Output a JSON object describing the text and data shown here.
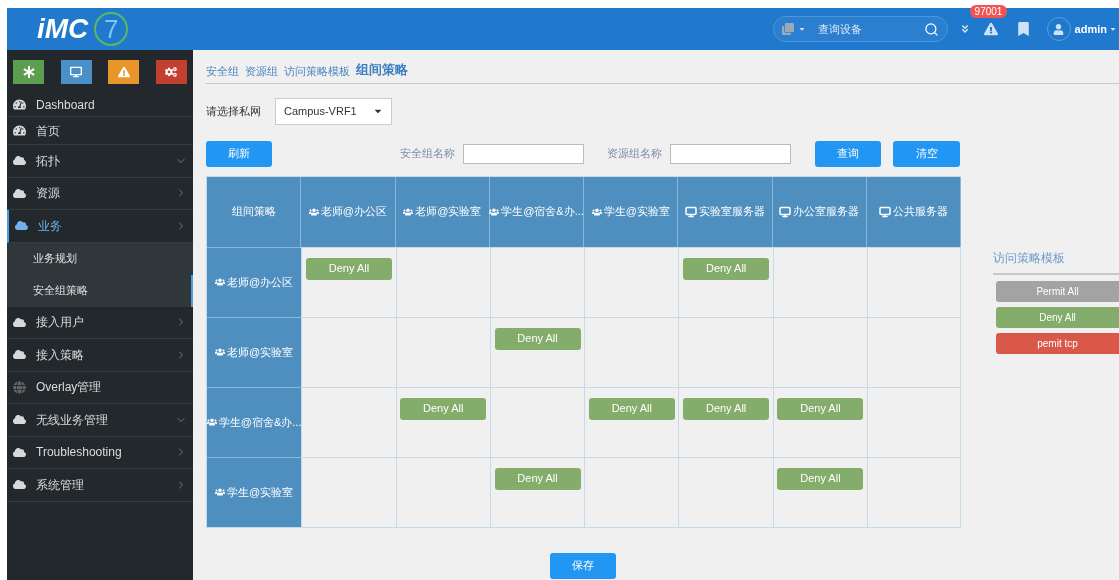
{
  "header": {
    "logo": "iMC",
    "logo_version": "7",
    "search": {
      "placeholder": "查询设备"
    },
    "alarm_badge": "97001",
    "user": "admin"
  },
  "quick_buttons": [
    {
      "kind": "asterisk",
      "color": "#5a9e4e"
    },
    {
      "kind": "monitor",
      "color": "#4a90c8"
    },
    {
      "kind": "warning",
      "color": "#e8962a"
    },
    {
      "kind": "gears",
      "color": "#c2402f"
    }
  ],
  "sidebar": {
    "items": [
      {
        "label": "Dashboard",
        "kind": "gauge",
        "selected": false
      },
      {
        "label": "首页",
        "kind": "gauge",
        "selected": false
      },
      {
        "label": "拓扑",
        "kind": "cloud",
        "expanded": true,
        "selected": false
      },
      {
        "label": "资源",
        "kind": "cloud",
        "expanded": false,
        "selected": false
      },
      {
        "label": "业务",
        "kind": "cloud",
        "expanded": false,
        "selected": true,
        "children": [
          {
            "label": "业务规划",
            "selected": false
          },
          {
            "label": "安全组策略",
            "selected": true
          }
        ]
      },
      {
        "label": "接入用户",
        "kind": "cloud",
        "expanded": false,
        "selected": false
      },
      {
        "label": "接入策略",
        "kind": "cloud",
        "expanded": false,
        "selected": false
      },
      {
        "label": "Overlay管理",
        "kind": "globe",
        "selected": false
      },
      {
        "label": "无线业务管理",
        "kind": "cloud",
        "expanded": true,
        "selected": false
      },
      {
        "label": "Troubleshooting",
        "kind": "cloud",
        "expanded": false,
        "selected": false
      },
      {
        "label": "系统管理",
        "kind": "cloud",
        "expanded": false,
        "selected": false
      }
    ]
  },
  "breadcrumb": [
    {
      "label": "安全组",
      "selected": false
    },
    {
      "label": "资源组",
      "selected": false
    },
    {
      "label": "访问策略模板",
      "selected": false
    },
    {
      "label": "组间策略",
      "selected": true
    }
  ],
  "vpn_select": {
    "label": "请选择私网",
    "value": "Campus-VRF1"
  },
  "toolbar": {
    "refresh": "刷新",
    "security_group_label": "安全组名称",
    "resource_group_label": "资源组名称",
    "query": "查询",
    "clear": "清空"
  },
  "matrix": {
    "corner": "组间策略",
    "columns": [
      {
        "label": "老师@办公区",
        "kind": "user"
      },
      {
        "label": "老师@实验室",
        "kind": "user"
      },
      {
        "label": "学生@宿舍&办...",
        "kind": "user"
      },
      {
        "label": "学生@实验室",
        "kind": "user"
      },
      {
        "label": "实验室服务器",
        "kind": "server"
      },
      {
        "label": "办公室服务器",
        "kind": "server"
      },
      {
        "label": "公共服务器",
        "kind": "server"
      }
    ],
    "rows": [
      {
        "label": "老师@办公区",
        "kind": "user",
        "cells": [
          {
            "rule": "Deny All",
            "color": "#84ad6b"
          },
          {},
          {},
          {},
          {
            "rule": "Deny All",
            "color": "#84ad6b"
          },
          {},
          {}
        ]
      },
      {
        "label": "老师@实验室",
        "kind": "user",
        "cells": [
          {},
          {},
          {
            "rule": "Deny All",
            "color": "#84ad6b"
          },
          {},
          {},
          {},
          {}
        ]
      },
      {
        "label": "学生@宿舍&办...",
        "kind": "user",
        "cells": [
          {},
          {
            "rule": "Deny All",
            "color": "#84ad6b"
          },
          {},
          {
            "rule": "Deny All",
            "color": "#84ad6b"
          },
          {
            "rule": "Deny All",
            "color": "#84ad6b"
          },
          {
            "rule": "Deny All",
            "color": "#84ad6b"
          },
          {}
        ]
      },
      {
        "label": "学生@实验室",
        "kind": "user",
        "cells": [
          {},
          {},
          {
            "rule": "Deny All",
            "color": "#84ad6b"
          },
          {},
          {},
          {
            "rule": "Deny All",
            "color": "#84ad6b"
          },
          {}
        ]
      }
    ]
  },
  "templates": {
    "title": "访问策略模板",
    "items": [
      {
        "label": "Permit All",
        "color": "#a3a3a3"
      },
      {
        "label": "Deny All",
        "color": "#84ad6b"
      },
      {
        "label": "pemit tcp",
        "color": "#d9584a"
      }
    ]
  },
  "save": "保存"
}
